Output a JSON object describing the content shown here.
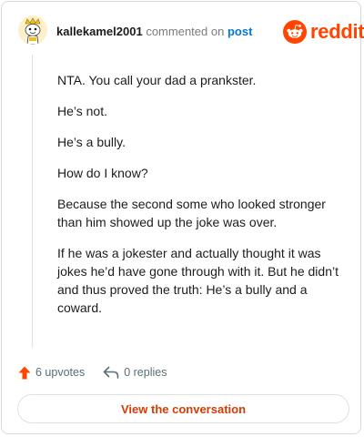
{
  "comment": {
    "username": "kallekamel2001",
    "action_text": "commented on",
    "post_link_label": "post",
    "avatar_icon": "snoo-avatar-icon",
    "body": [
      "NTA. You call your dad a prankster.",
      "He’s not.",
      "He’s a bully.",
      "How do I know?",
      "Because the second some who looked stronger than him showed up the joke was over.",
      "If he was a jokester and actually thought it was jokes he’d have gone through with it. But he didn’t and thus proved the truth: He’s a bully and a coward."
    ]
  },
  "brand": {
    "name": "reddit",
    "logo_icon": "reddit-snoo-icon",
    "color": "#ff4500"
  },
  "actions": {
    "upvotes_label": "6 upvotes",
    "upvote_icon": "upvote-arrow-icon",
    "upvote_color": "#ff4500",
    "replies_label": "0 replies",
    "reply_icon": "reply-arrow-icon"
  },
  "cta": {
    "label": "View the conversation",
    "color": "#d93a00"
  }
}
